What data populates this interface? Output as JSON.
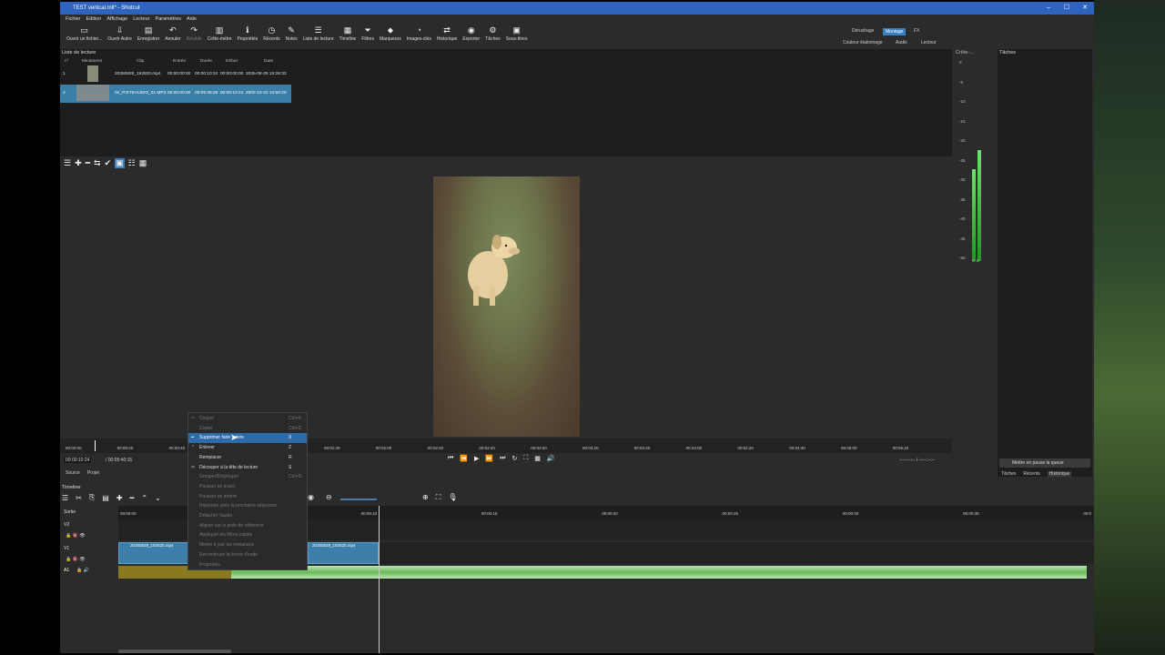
{
  "window": {
    "title": "TEST vertical.mlt* - Shotcut",
    "controls": [
      "–",
      "☐",
      "✕"
    ]
  },
  "menu": [
    "Fichier",
    "Edition",
    "Affichage",
    "Lecteur",
    "Paramètres",
    "Aide"
  ],
  "toolbar": [
    {
      "label": "Ouvrir un fichier...",
      "icon": "folder-icon",
      "glyph": "▭"
    },
    {
      "label": "Ouvrir Autre",
      "icon": "open-other-icon",
      "glyph": "⇩"
    },
    {
      "label": "Enregistrer",
      "icon": "save-icon",
      "glyph": "▤"
    },
    {
      "label": "Annuler",
      "icon": "undo-icon",
      "glyph": "↶"
    },
    {
      "label": "Rétablir",
      "icon": "redo-icon",
      "glyph": "↷",
      "dim": true
    },
    {
      "label": "Crête-mètre",
      "icon": "peak-meter-icon",
      "glyph": "▥"
    },
    {
      "label": "Propriétés",
      "icon": "info-icon",
      "glyph": "ℹ"
    },
    {
      "label": "Récents",
      "icon": "clock-icon",
      "glyph": "◷"
    },
    {
      "label": "Notes",
      "icon": "note-icon",
      "glyph": "✎"
    },
    {
      "label": "Liste de lecture",
      "icon": "playlist-icon",
      "glyph": "☰"
    },
    {
      "label": "Timeline",
      "icon": "timeline-icon",
      "glyph": "▦"
    },
    {
      "label": "Filtres",
      "icon": "filter-icon",
      "glyph": "⏷"
    },
    {
      "label": "Marqueurs",
      "icon": "marker-icon",
      "glyph": "⬥"
    },
    {
      "label": "Images-clés",
      "icon": "keyframe-icon",
      "glyph": "◔"
    },
    {
      "label": "Historique",
      "icon": "history-icon",
      "glyph": "⇄"
    },
    {
      "label": "Exporter",
      "icon": "export-icon",
      "glyph": "◉"
    },
    {
      "label": "Tâches",
      "icon": "gear-icon",
      "glyph": "⚙"
    },
    {
      "label": "Sous-titres",
      "icon": "subtitle-icon",
      "glyph": "▣"
    }
  ],
  "modes": {
    "row1": [
      "Dérushage",
      "Montage",
      "FX"
    ],
    "row2": [
      "Couleur étalonnage",
      "Audio",
      "Lecteur"
    ],
    "active": "Montage"
  },
  "playlist": {
    "title": "Liste de lecture",
    "columns": [
      "n°",
      "Miniatures",
      "Clip",
      "Entrée",
      "Durée",
      "Début",
      "Date"
    ],
    "rows": [
      {
        "n": "1",
        "clip": "20250828_192820.mp4",
        "in": "00:00:00:00",
        "dur": "00:00:10:24",
        "start": "00:00:00:00",
        "date": "2025-08-28 19:28:33"
      },
      {
        "n": "2",
        "clip": "01_PISTEAUDIO_01.MP3",
        "in": "00:00:00:00",
        "dur": "00:05:35:26",
        "start": "00:00:10:24",
        "date": "2002-12-22 14:50:20"
      }
    ]
  },
  "playlist_tools": [
    "☰",
    "✚",
    "━",
    "⇆",
    "✔",
    "▣",
    "☷",
    "▦"
  ],
  "meter": {
    "title": "Crête-...",
    "scale": [
      "0",
      "-5",
      "-10",
      "-15",
      "-20",
      "-25",
      "-30",
      "-35",
      "-40",
      "-45",
      "-50"
    ],
    "channels": "G  D",
    "level_L_db": -28,
    "level_R_db": -23
  },
  "tasks": {
    "title": "Tâches",
    "queue_button": "Mettre en pause la queue",
    "tabs": [
      "Tâches",
      "Récents",
      "Historique"
    ],
    "active": "Historique"
  },
  "scrubber": [
    "00:00:00",
    "00:00:20",
    "00:00:40",
    "00:01:00",
    "00:01:20",
    "00:01:40",
    "00:02:00",
    "00:02:20",
    "00:02:40",
    "00:03:00",
    "00:03:20",
    "00:03:40",
    "00:04:00",
    "00:04:20",
    "00:04:40",
    "00:05:00",
    "00:05:20"
  ],
  "transport": {
    "timecode": "00:00:10:24",
    "duration": "00:05:40:15",
    "controls": [
      "⏮",
      "⏪",
      "▶",
      "⏩",
      "⏭",
      "↻",
      "⛶",
      "▦",
      "🔊"
    ],
    "in_out": "--:--:--:-- / --:--:--:--"
  },
  "source_tabs": [
    "Source",
    "Projet"
  ],
  "timeline": {
    "title": "Timeline",
    "output": "Sortie",
    "tracks": [
      "V2",
      "V1",
      "A1"
    ],
    "ruler": [
      "00:00:00",
      "00:00:05",
      "00:00:10",
      "00:00:15",
      "00:00:20",
      "00:00:25",
      "00:00:30",
      "00:00:35",
      "00:0"
    ],
    "clips": {
      "v1a": "20250828_192820.mp4",
      "v1b": "20250828_192820.mp4"
    }
  },
  "context_menu": [
    {
      "label": "Couper",
      "shortcut": "Ctrl+X",
      "dis": true,
      "icon": "✂"
    },
    {
      "label": "Copier",
      "shortcut": "Ctrl+C",
      "dis": true,
      "icon": ""
    },
    {
      "label": "Supprimer faire suivre",
      "shortcut": "X",
      "hl": true,
      "icon": "━"
    },
    {
      "label": "Enlever",
      "shortcut": "Z",
      "icon": "⌃"
    },
    {
      "label": "Remplacer",
      "shortcut": "R",
      "icon": ""
    },
    {
      "label": "Découper à la tête de lecture",
      "shortcut": "S",
      "icon": "✂"
    },
    {
      "label": "Grouper/Dégrouper",
      "shortcut": "Ctrl+G",
      "dis": true,
      "icon": ""
    },
    {
      "label": "Pousser en avant",
      "shortcut": "",
      "dis": true,
      "icon": ""
    },
    {
      "label": "Pousser en arrière",
      "shortcut": "",
      "dis": true,
      "icon": ""
    },
    {
      "label": "Rejoindre avec la prochaine séquence",
      "shortcut": "",
      "dis": true,
      "icon": ""
    },
    {
      "label": "Détacher l'audio",
      "shortcut": "",
      "dis": true,
      "icon": ""
    },
    {
      "label": "Aligner sur la piste de référence",
      "shortcut": "",
      "dis": true,
      "icon": ""
    },
    {
      "label": "Appliquer les filtres copiés",
      "shortcut": "",
      "dis": true,
      "icon": ""
    },
    {
      "label": "Mettre à jour les miniatures",
      "shortcut": "",
      "dis": true,
      "icon": ""
    },
    {
      "label": "Reconstruire la forme d'onde",
      "shortcut": "",
      "dis": true,
      "icon": ""
    },
    {
      "label": "Propriétés",
      "shortcut": "",
      "dis": true,
      "icon": ""
    }
  ]
}
